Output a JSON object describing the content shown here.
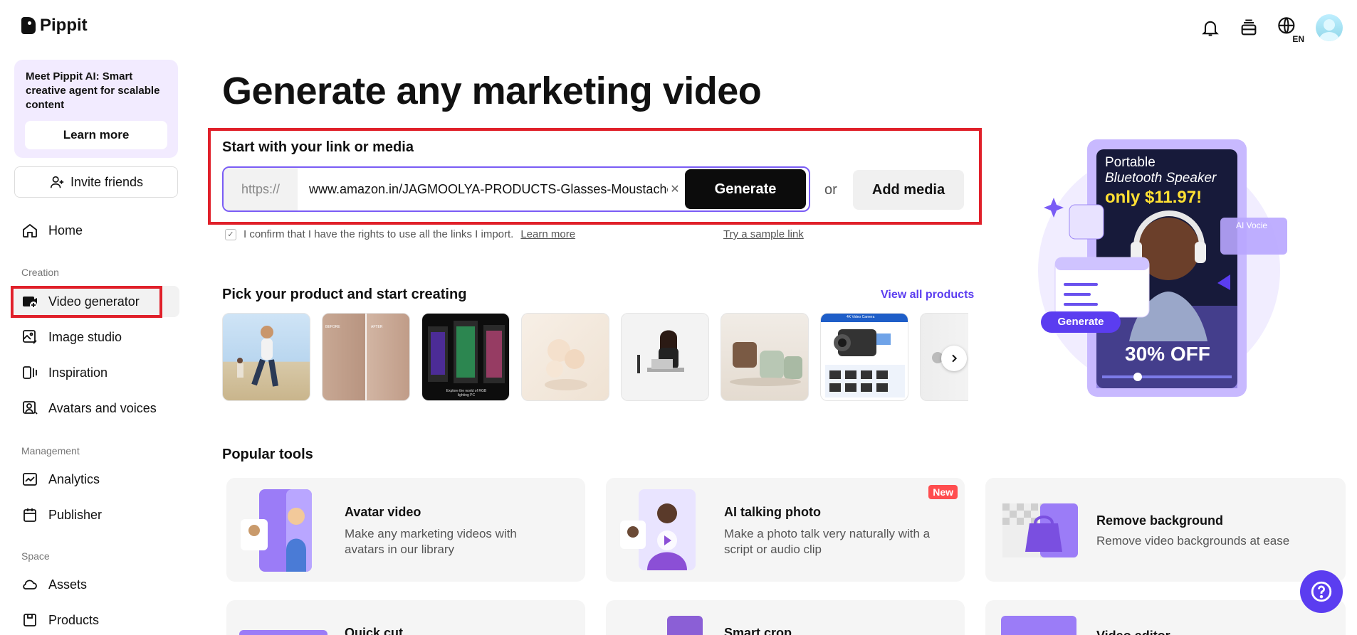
{
  "app": {
    "name": "Pippit"
  },
  "sidebar": {
    "promo": {
      "text": "Meet Pippit AI: Smart creative agent for scalable content",
      "button": "Learn more"
    },
    "invite": "Invite friends",
    "home": "Home",
    "sections": {
      "creation": "Creation",
      "management": "Management",
      "space": "Space"
    },
    "items": {
      "video_generator": "Video generator",
      "image_studio": "Image studio",
      "inspiration": "Inspiration",
      "avatars_voices": "Avatars and voices",
      "analytics": "Analytics",
      "publisher": "Publisher",
      "assets": "Assets",
      "products": "Products"
    }
  },
  "topbar": {
    "language": "EN"
  },
  "main": {
    "headline": "Generate any marketing video",
    "link_label": "Start with your link or media",
    "url_prefix": "https://",
    "url_value": "www.amazon.in/JAGMOOLYA-PRODUCTS-Glasses-Moustache",
    "generate": "Generate",
    "or": "or",
    "add_media": "Add media",
    "confirm_text": "I confirm that I have the rights to use all the links I import.",
    "confirm_link": "Learn more",
    "sample_link": "Try a sample link",
    "pick_title": "Pick your product and start creating",
    "view_all": "View all products",
    "thumb_texts": {
      "before": "BEFORE",
      "after": "AFTER",
      "rgb": "Explore the world of RGB lighting PC",
      "camera": "4K Video Camera"
    }
  },
  "hero": {
    "line1": "Portable",
    "line2": "Bluetooth Speaker",
    "price": "only $11.97!",
    "discount": "30% OFF",
    "ai_voice": "AI Vocie",
    "generate": "Generate"
  },
  "tools": {
    "title": "Popular tools",
    "avatar_video": {
      "title": "Avatar video",
      "desc": "Make any marketing videos with avatars in our library"
    },
    "talking_photo": {
      "title": "AI talking photo",
      "desc": "Make a photo talk very naturally with a script or audio clip",
      "badge": "New"
    },
    "remove_bg": {
      "title": "Remove background",
      "desc": "Remove video backgrounds at ease"
    },
    "quick_cut": {
      "title": "Quick cut"
    },
    "smart_crop": {
      "title": "Smart crop"
    },
    "video_editor": {
      "title": "Video editor"
    }
  },
  "colors": {
    "accent": "#5b3df0",
    "highlight": "#e0202a",
    "promo_bg": "#f2ebff"
  }
}
